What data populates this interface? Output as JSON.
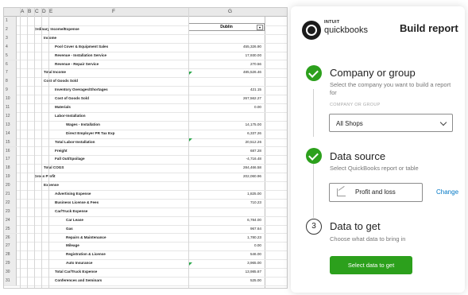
{
  "spreadsheet": {
    "column_headers": [
      "A",
      "B",
      "C",
      "D",
      "E",
      "F",
      "G"
    ],
    "location_header": "Dublin",
    "rows": [
      {
        "n": "1",
        "label": "",
        "value": ""
      },
      {
        "n": "2",
        "label": "Ordinary Income/Expense",
        "value": "",
        "indent": 1
      },
      {
        "n": "3",
        "label": "Income",
        "value": "",
        "indent": 2
      },
      {
        "n": "4",
        "label": "Pool Cover & Equipment Sales",
        "value": "455,326.90",
        "indent": 3
      },
      {
        "n": "5",
        "label": "Revenue - Installation Service",
        "value": "17,930.00",
        "indent": 3
      },
      {
        "n": "6",
        "label": "Revenue - Repair Service",
        "value": "270.56",
        "indent": 3
      },
      {
        "n": "7",
        "label": "Total Income",
        "value": "485,526.46",
        "indent": 2
      },
      {
        "n": "8",
        "label": "Cost of Goods Sold",
        "value": "",
        "indent": 2
      },
      {
        "n": "9",
        "label": "Inventory Overages/Shortages",
        "value": "421.15",
        "indent": 3
      },
      {
        "n": "10",
        "label": "Cost of Goods Sold",
        "value": "267,562.27",
        "indent": 3
      },
      {
        "n": "11",
        "label": "Materials",
        "value": "0.00",
        "indent": 3
      },
      {
        "n": "12",
        "label": "Labor-Installation",
        "value": "",
        "indent": 3
      },
      {
        "n": "13",
        "label": "Wages - Installation",
        "value": "14,175.00",
        "indent": 4
      },
      {
        "n": "14",
        "label": "Direct Employer PR Tax Exp",
        "value": "6,337.26",
        "indent": 4
      },
      {
        "n": "15",
        "label": "Total Labor-Installation",
        "value": "20,512.26",
        "indent": 3
      },
      {
        "n": "16",
        "label": "Freight",
        "value": "687.28",
        "indent": 3
      },
      {
        "n": "17",
        "label": "Fall Out/Spoilage",
        "value": "-4,716.48",
        "indent": 3
      },
      {
        "n": "18",
        "label": "Total COGS",
        "value": "284,466.58",
        "indent": 2
      },
      {
        "n": "19",
        "label": "Gross Profit",
        "value": "202,060.96",
        "indent": 1
      },
      {
        "n": "20",
        "label": "Expense",
        "value": "",
        "indent": 2
      },
      {
        "n": "21",
        "label": "Advertising Expense",
        "value": "1,825.00",
        "indent": 3
      },
      {
        "n": "22",
        "label": "Business License & Fees",
        "value": "710.23",
        "indent": 3
      },
      {
        "n": "23",
        "label": "Car/Truck Expense",
        "value": "",
        "indent": 3
      },
      {
        "n": "24",
        "label": "Car Lease",
        "value": "6,784.00",
        "indent": 4
      },
      {
        "n": "25",
        "label": "Gas",
        "value": "967.64",
        "indent": 4
      },
      {
        "n": "26",
        "label": "Repairs & Maintenance",
        "value": "1,780.23",
        "indent": 4
      },
      {
        "n": "27",
        "label": "Mileage",
        "value": "0.00",
        "indent": 4
      },
      {
        "n": "28",
        "label": "Registration & License",
        "value": "546.00",
        "indent": 4
      },
      {
        "n": "29",
        "label": "Auto Insurance",
        "value": "3,965.00",
        "indent": 4
      },
      {
        "n": "30",
        "label": "Total Car/Truck Expense",
        "value": "13,985.87",
        "indent": 3
      },
      {
        "n": "31",
        "label": "Conferences and Seminars",
        "value": "525.00",
        "indent": 3
      }
    ]
  },
  "panel": {
    "brand_top": "INTUIT",
    "brand_name": "quickbooks",
    "title": "Build report",
    "step1": {
      "title": "Company or group",
      "desc": "Select the company you want to build a report for",
      "field_label": "COMPANY OR GROUP",
      "selected": "All Shops"
    },
    "step2": {
      "title": "Data source",
      "desc": "Select QuickBooks report or table",
      "source": "Profit and loss",
      "change": "Change"
    },
    "step3": {
      "number": "3",
      "title": "Data to get",
      "desc": "Choose what data to bring in",
      "button": "Select data to get"
    },
    "colors": {
      "accent_green": "#2ca01c",
      "link_blue": "#0077c5"
    },
    "icons": [
      "check-icon",
      "chevron-down-icon",
      "chart-icon"
    ]
  }
}
